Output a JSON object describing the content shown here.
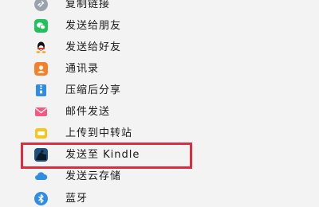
{
  "share_menu": {
    "items": [
      {
        "label": "复制链接",
        "icon": "link-icon"
      },
      {
        "label": "发送给朋友",
        "icon": "wechat-icon"
      },
      {
        "label": "发送给好友",
        "icon": "qq-penguin-icon"
      },
      {
        "label": "通讯录",
        "icon": "contacts-icon"
      },
      {
        "label": "压缩后分享",
        "icon": "zip-icon"
      },
      {
        "label": "邮件发送",
        "icon": "mail-icon"
      },
      {
        "label": "上传到中转站",
        "icon": "transfer-station-icon"
      },
      {
        "label": "发送至 Kindle",
        "icon": "kindle-icon"
      },
      {
        "label": "发送云存储",
        "icon": "cloud-icon"
      },
      {
        "label": "蓝牙",
        "icon": "bluetooth-icon"
      }
    ],
    "highlighted_item": "发送至 Kindle"
  },
  "colors": {
    "highlight_border": "#e02a3e",
    "wechat_green": "#21c25e",
    "contacts_orange": "#f4812a",
    "accent_blue": "#2f8de4",
    "mail_pink": "#f25a82",
    "transfer_yellow": "#f5c61c"
  }
}
